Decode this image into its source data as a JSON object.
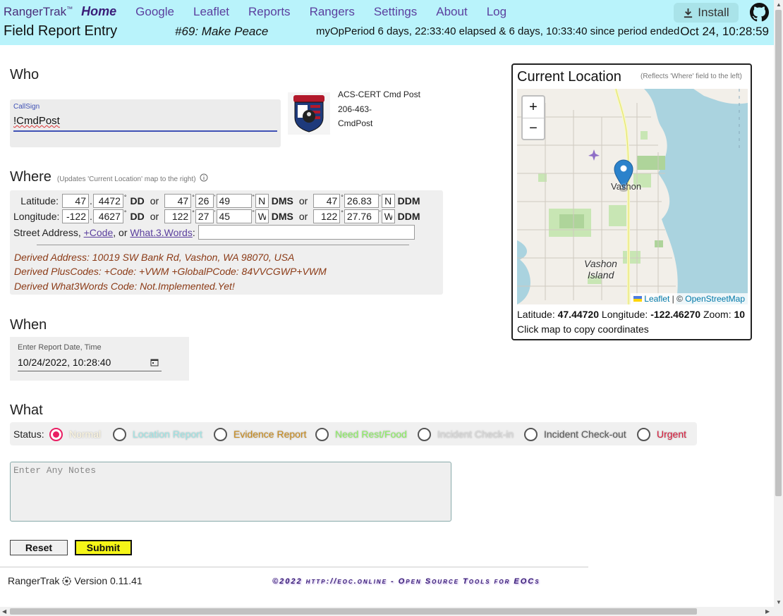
{
  "header": {
    "brand": "RangerTrak",
    "brand_tm": "™",
    "nav_home": "Home",
    "nav_links": [
      "Google",
      "Leaflet",
      "Reports",
      "Rangers",
      "Settings",
      "About",
      "Log"
    ],
    "page_title": "Field Report Entry",
    "incident": "#69: Make Peace",
    "op_period": "myOpPeriod 6 days, 22:33:40 elapsed & 6 days, 10:33:40 since period ended",
    "clock": "Oct 24, 10:28:59",
    "install_label": "Install"
  },
  "who": {
    "title": "Who",
    "callsign_label": "CallSign",
    "callsign_value": "!CmdPost",
    "ranger_info": [
      "ACS-CERT Cmd Post",
      "206-463-",
      "CmdPost"
    ]
  },
  "where": {
    "title": "Where",
    "note": "(Updates 'Current Location' map to the right)",
    "lat_label": "Latitude:",
    "lon_label": "Longitude:",
    "lat": {
      "dd_int": "47",
      "dd_frac": "4472",
      "dms_d": "47",
      "dms_m": "26",
      "dms_s": "49",
      "dms_h": "N",
      "ddm_d": "47",
      "ddm_m": "26.83",
      "ddm_h": "N"
    },
    "lon": {
      "dd_int": "-122",
      "dd_frac": "4627",
      "dms_d": "122",
      "dms_m": "27",
      "dms_s": "45",
      "dms_h": "W",
      "ddm_d": "122",
      "ddm_m": "27.76",
      "ddm_h": "W"
    },
    "unit_dd": "DD",
    "unit_dms": "DMS",
    "unit_ddm": "DDM",
    "or": "or",
    "addr_prefix": "Street Address,",
    "addr_code": "+Code",
    "addr_or": ", or",
    "addr_w3w": "What.3.Words",
    "addr_suffix": ":",
    "derived_address": "Derived Address: 10019 SW Bank Rd, Vashon, WA 98070, USA",
    "derived_plus": "Derived PlusCodes: +Code: +VWM +GlobalPCode: 84VVCGWP+VWM",
    "derived_w3w": "Derived What3Words Code: Not.Implemented.Yet!"
  },
  "when": {
    "title": "When",
    "label": "Enter Report Date, Time",
    "value": "10/24/2022, 10:28:40"
  },
  "what": {
    "title": "What",
    "status_label": "Status:",
    "statuses": [
      {
        "label": "Normal",
        "color": "#fff8e0"
      },
      {
        "label": "Location Report",
        "color": "#9ee6e6"
      },
      {
        "label": "Evidence Report",
        "color": "#c78a1c"
      },
      {
        "label": "Need Rest/Food",
        "color": "#8cf063"
      },
      {
        "label": "Incident Check-in",
        "color": "#d8d8d8"
      },
      {
        "label": "Incident Check-out",
        "color": "#5a5a5a"
      },
      {
        "label": "Urgent",
        "color": "#d81b3c"
      }
    ],
    "notes_placeholder": "Enter Any Notes",
    "reset_label": "Reset",
    "submit_label": "Submit"
  },
  "map": {
    "title": "Current Location",
    "note": "(Reflects 'Where' field to the left)",
    "zoom_in": "+",
    "zoom_out": "−",
    "attrib_leaflet": "Leaflet",
    "attrib_sep": " | © ",
    "attrib_osm": "OpenStreetMap",
    "label_town": "Vashon",
    "label_island_1": "Vashon",
    "label_island_2": "Island",
    "lat_label": "Latitude:",
    "lat_value": "47.44720",
    "lon_label": "Longitude:",
    "lon_value": "-122.46270",
    "zoom_label": "Zoom:",
    "zoom_value": "10",
    "copy_hint": "Click map to copy coordinates"
  },
  "footer": {
    "app": "RangerTrak",
    "version": "Version 0.11.41",
    "credit": "©2022 http://eoc.online - Open Source Tools for EOCs"
  }
}
